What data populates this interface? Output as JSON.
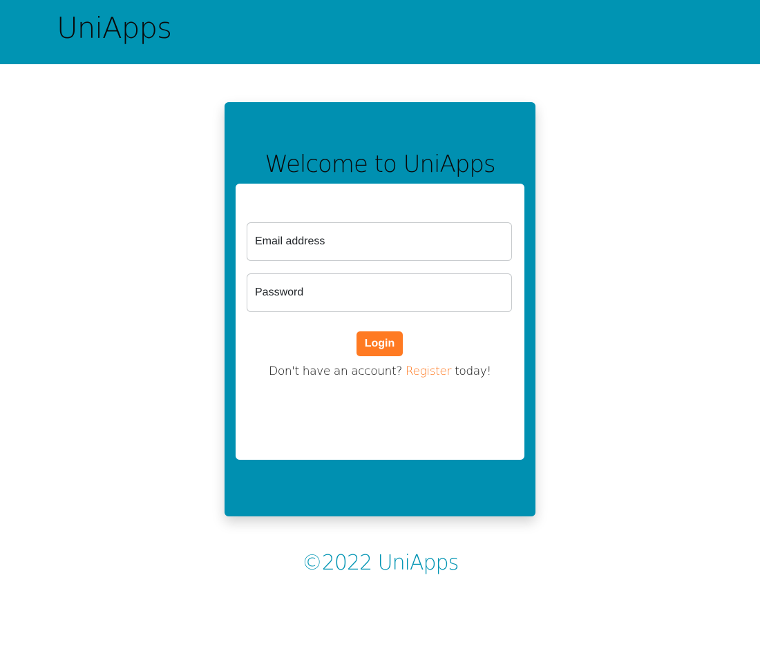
{
  "header": {
    "brand": "UniApps"
  },
  "login_card": {
    "title": "Welcome to UniApps",
    "email": {
      "placeholder": "Email address",
      "value": ""
    },
    "password": {
      "placeholder": "Password",
      "value": ""
    },
    "login_label": "Login",
    "register": {
      "prefix": "Don't have an account? ",
      "link_label": "Register",
      "suffix": " today!"
    }
  },
  "footer": {
    "copyright": "©2022 UniApps"
  },
  "colors": {
    "header_bg": "#0094b3",
    "card_bg": "#0090b1",
    "accent": "#ff7a22",
    "footer_text": "#0094b3"
  }
}
